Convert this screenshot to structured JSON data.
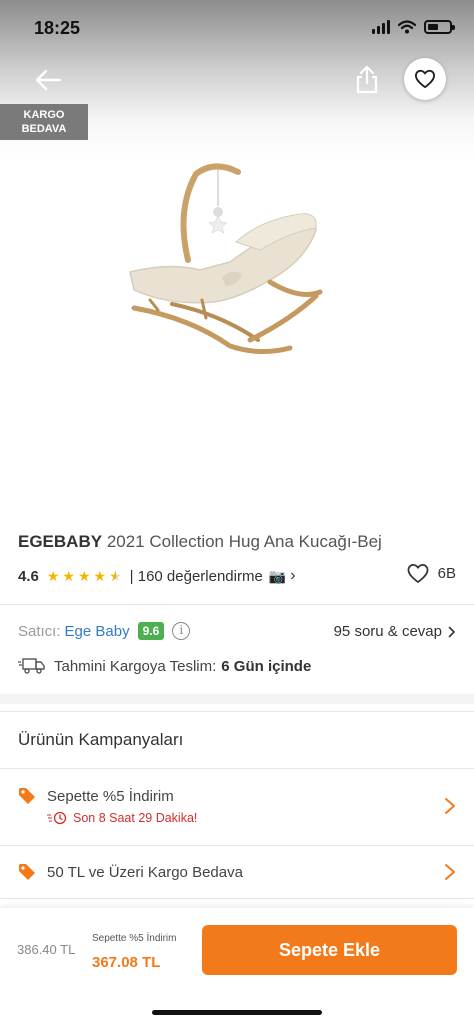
{
  "status_bar": {
    "time": "18:25"
  },
  "header": {
    "back_icon": "arrow-left-icon",
    "share_icon": "share-icon",
    "favorite_icon": "heart-icon",
    "badge_line1": "KARGO",
    "badge_line2": "BEDAVA"
  },
  "product": {
    "brand": "EGEBABY",
    "name": "2021 Collection Hug Ana Kucağı-Bej",
    "rating": "4.6",
    "rating_stars": 4.6,
    "review_count_text": "| 160 değerlendirme",
    "like_count": "6B"
  },
  "seller": {
    "label": "Satıcı:",
    "name": "Ege Baby",
    "score": "9.6",
    "qa_link": "95 soru & cevap"
  },
  "delivery": {
    "label": "Tahmini Kargoya Teslim:",
    "value": "6 Gün içinde"
  },
  "campaigns": {
    "title": "Ürünün Kampanyaları",
    "items": [
      {
        "label": "Sepette %5 İndirim",
        "timer": "Son 8 Saat 29 Dakika!"
      },
      {
        "label": "50 TL ve Üzeri Kargo Bedava"
      }
    ]
  },
  "bottom_bar": {
    "old_price": "386.40 TL",
    "discount_label": "Sepette %5 İndirim",
    "new_price": "367.08 TL",
    "add_to_cart": "Sepete Ekle"
  },
  "colors": {
    "accent": "#f27a1a",
    "seller_link": "#2f7dc8",
    "score_badge": "#4caf50",
    "timer_red": "#d32f2f"
  }
}
